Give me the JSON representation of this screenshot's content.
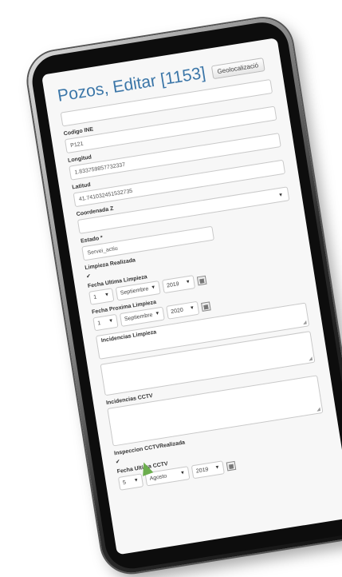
{
  "header": {
    "title": "Pozos, Editar [1153]",
    "geo_button": "Geolocalizació"
  },
  "fields": {
    "top_value": "",
    "codigo_label": "Codigo INE",
    "codigo_value": "P121",
    "longitud_label": "Longitud",
    "longitud_value": "1.833759857732337",
    "latitud_label": "Latitud",
    "latitud_value": "41.741032451532735",
    "coord_label": "Coordenada Z",
    "coord_value": "",
    "estado_label": "Estado *",
    "estado_value": "Servei_actiu",
    "limpieza_label": "Limpieza Realizada",
    "fecha_ultima_limpieza_label": "Fecha Ultima Limpieza",
    "fecha_ultima_limpieza": {
      "day": "1",
      "month": "Septiembre",
      "year": "2019"
    },
    "fecha_proxima_label": "Fecha Proxima Limpieza",
    "fecha_proxima": {
      "day": "1",
      "month": "Septiembre",
      "year": "2020"
    },
    "incidencias_limpieza_label": "Incidencias Limpieza",
    "incidencias_cctv_label": "Incidencias CCTV",
    "inspeccion_label": "Inspeccion CCTVRealizada",
    "fecha_ultima_cctv_label": "Fecha Ultima CCTV",
    "fecha_ultima_cctv": {
      "day": "5",
      "month": "Agosto",
      "year": "2019"
    }
  },
  "icons": {
    "checkbox": "checkmark-icon",
    "calendar": "calendar-icon",
    "dropdown": "triangle-down-icon"
  }
}
